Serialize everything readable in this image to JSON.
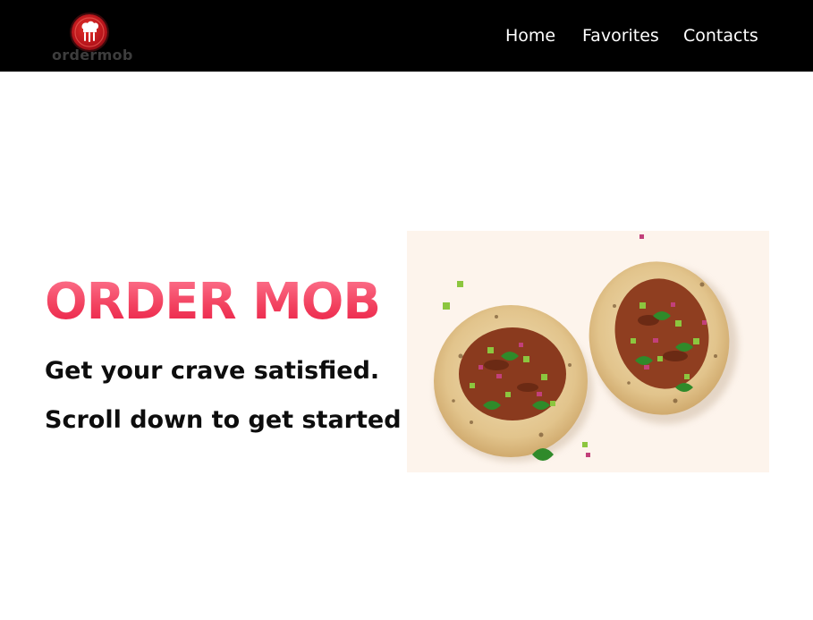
{
  "header": {
    "logo": {
      "text": "ordermob",
      "icon": "chef-hat-utensils-icon",
      "badge_color": "#c8171f"
    },
    "nav": [
      {
        "label": "Home"
      },
      {
        "label": "Favorites"
      },
      {
        "label": "Contacts"
      }
    ],
    "background": "#000000"
  },
  "hero": {
    "title": "ORDER MOB",
    "title_color": "#ef3558",
    "subtitle_1": "Get your crave satisfied.",
    "subtitle_2": "Scroll down to get started",
    "image": {
      "depicts": "two pulled-meat tacos with chopped cucumber, red onion and cilantro",
      "icon": "tacos-photo"
    }
  }
}
